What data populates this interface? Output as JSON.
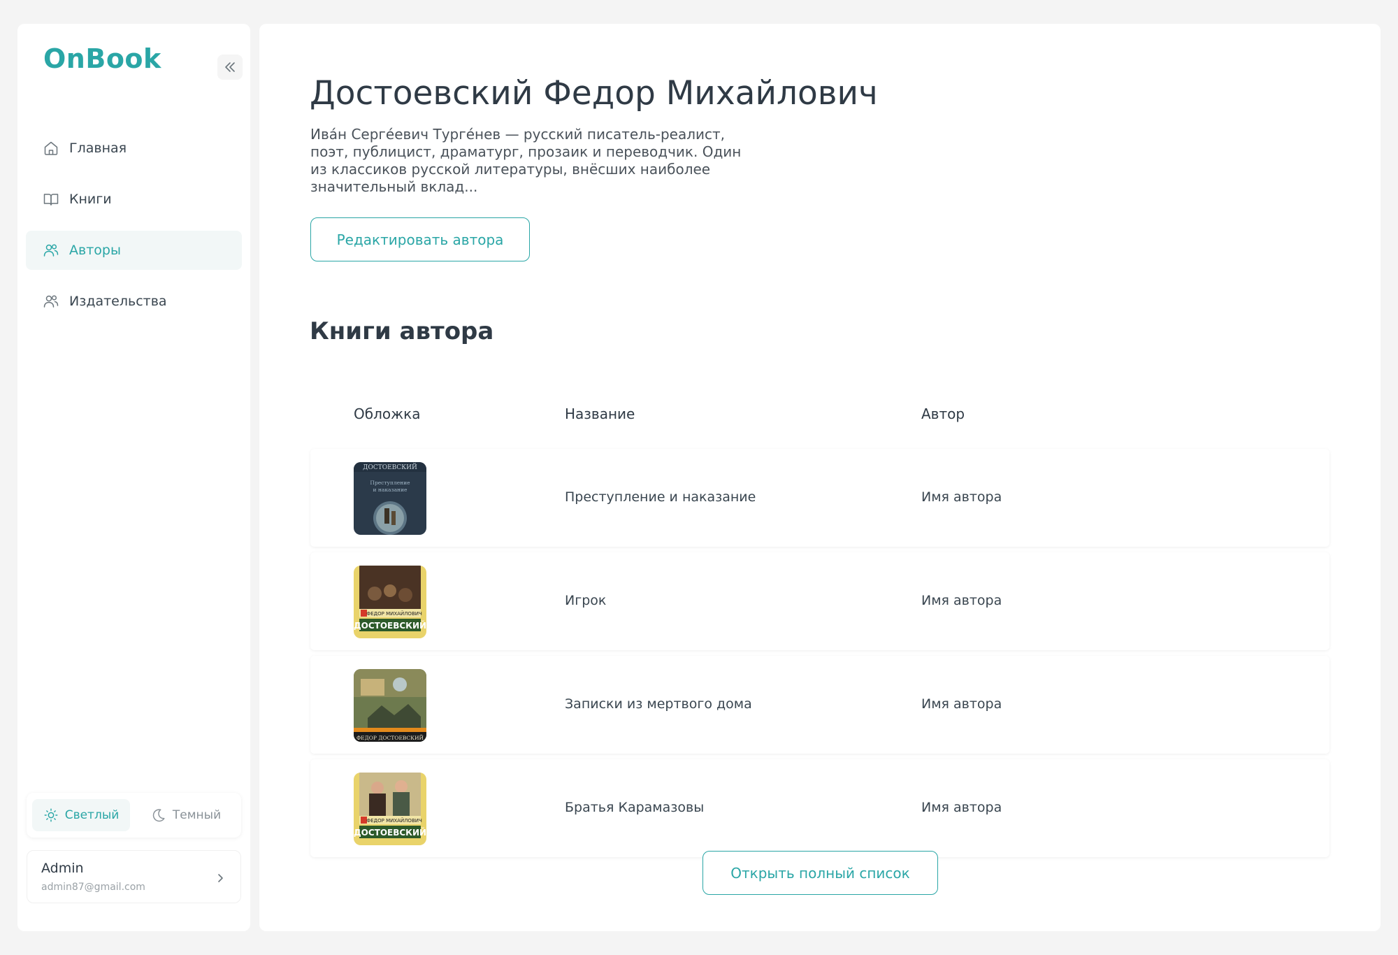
{
  "app": {
    "logo": "OnBook"
  },
  "sidebar": {
    "items": [
      {
        "label": "Главная",
        "icon": "home-icon",
        "active": false
      },
      {
        "label": "Книги",
        "icon": "book-icon",
        "active": false
      },
      {
        "label": "Авторы",
        "icon": "users-icon",
        "active": true
      },
      {
        "label": "Издательства",
        "icon": "users-icon",
        "active": false
      }
    ],
    "theme": {
      "light_label": "Светлый",
      "dark_label": "Темный",
      "selected": "light"
    },
    "user": {
      "name": "Admin",
      "email": "admin87@gmail.com"
    }
  },
  "author": {
    "name": "Достоевский Федор Михайлович",
    "bio": "Ива́н Серге́евич Турге́нев — русский писатель-реалист, поэт, публицист, драматург, прозаик и переводчик. Один из классиков русской литературы, внёсших наиболее значительный вклад...",
    "edit_label": "Редактировать автора"
  },
  "books_section": {
    "title": "Книги автора",
    "columns": {
      "cover": "Обложка",
      "title": "Название",
      "author": "Автор"
    },
    "rows": [
      {
        "title": "Преступление и наказание",
        "author": "Имя автора",
        "cover_text": "ДОСТОЕВСКИЙ",
        "cover_subtext": "Преступление и наказание"
      },
      {
        "title": "Игрок",
        "author": "Имя автора",
        "cover_text": "ДОСТОЕВСКИЙ",
        "cover_subtext": "ФЕДОР МИХАЙЛОВИЧ"
      },
      {
        "title": "Записки из мертвого дома",
        "author": "Имя автора",
        "cover_text": "ФЕДОР ДОСТОЕВСКИЙ"
      },
      {
        "title": "Братья Карамазовы",
        "author": "Имя автора",
        "cover_text": "ДОСТОЕВСКИЙ",
        "cover_subtext": "ФЕДОР МИХАЙЛОВИЧ"
      }
    ],
    "open_full_list_label": "Открыть полный список"
  },
  "colors": {
    "accent": "#2aa6a6",
    "text": "#2f3a45",
    "background": "#f4f4f4"
  }
}
